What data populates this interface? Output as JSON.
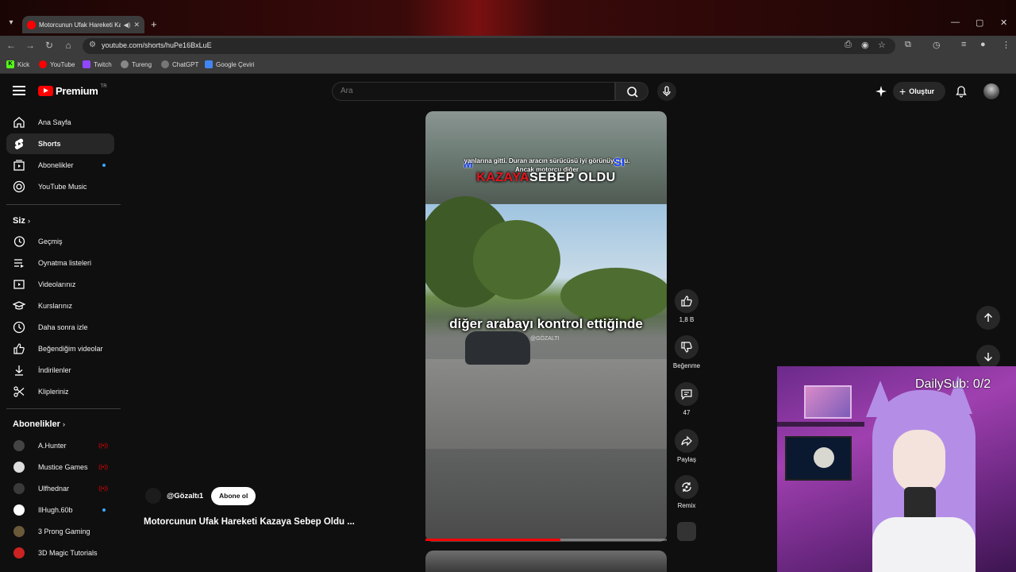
{
  "browser": {
    "tab_title": "Motorcunun Ufak Hareketi Kazaya Sebep Oldu",
    "url": "youtube.com/shorts/huPe16BxLuE",
    "bookmarks": [
      "Kick",
      "YouTube",
      "Twitch",
      "Tureng",
      "ChatGPT",
      "Google Çeviri"
    ]
  },
  "header": {
    "logo_text": "Premium",
    "country_code": "TR",
    "search_placeholder": "Ara",
    "create_label": "Oluştur"
  },
  "sidebar": {
    "main_items": [
      {
        "label": "Ana Sayfa",
        "icon": "home-icon"
      },
      {
        "label": "Shorts",
        "icon": "shorts-icon",
        "active": true
      },
      {
        "label": "Abonelikler",
        "icon": "subscriptions-icon",
        "new": true
      },
      {
        "label": "YouTube Music",
        "icon": "music-icon"
      }
    ],
    "you_heading": "Siz",
    "you_items": [
      {
        "label": "Geçmiş",
        "icon": "history-icon"
      },
      {
        "label": "Oynatma listeleri",
        "icon": "playlist-icon"
      },
      {
        "label": "Videolarınız",
        "icon": "your-videos-icon"
      },
      {
        "label": "Kurslarınız",
        "icon": "courses-icon"
      },
      {
        "label": "Daha sonra izle",
        "icon": "watch-later-icon"
      },
      {
        "label": "Beğendiğim videolar",
        "icon": "liked-icon"
      },
      {
        "label": "İndirilenler",
        "icon": "download-icon"
      },
      {
        "label": "Klipleriniz",
        "icon": "clips-icon"
      }
    ],
    "subs_heading": "Abonelikler",
    "subscriptions": [
      {
        "label": "A.Hunter",
        "live": true,
        "color": "#444444"
      },
      {
        "label": "Mustice Games",
        "live": true,
        "color": "#555555"
      },
      {
        "label": "Ulfhednar",
        "live": true,
        "color": "#3a3a3a"
      },
      {
        "label": "IlHugh.60b",
        "new": true,
        "color": "#ffffff"
      },
      {
        "label": "3 Prong Gaming",
        "color": "#6a5a3a"
      },
      {
        "label": "3D Magic Tutorials",
        "color": "#cc2222"
      }
    ]
  },
  "short": {
    "caption_top": "yanlarına gitti. Duran aracın sürücüsü iyi görünüyordu. Ancak motorcu diğer",
    "caption_m": "M",
    "caption_si": "SI",
    "caption_red": "KAZAYA",
    "caption_white": "SEBEP OLDU",
    "caption_mid": "diğer arabayı kontrol ettiğinde",
    "watermark": "@GÖZALTI",
    "progress": 0.56,
    "channel": "@Gözaltı1",
    "subscribe_label": "Abone ol",
    "title": "Motorcunun Ufak Hareketi Kazaya Sebep Oldu ..."
  },
  "actions": {
    "like_count": "1,8 B",
    "dislike_label": "Beğenme",
    "comment_count": "47",
    "share_label": "Paylaş",
    "remix_label": "Remix"
  },
  "overlay": {
    "counter_text": "DailySub: 0/2"
  }
}
